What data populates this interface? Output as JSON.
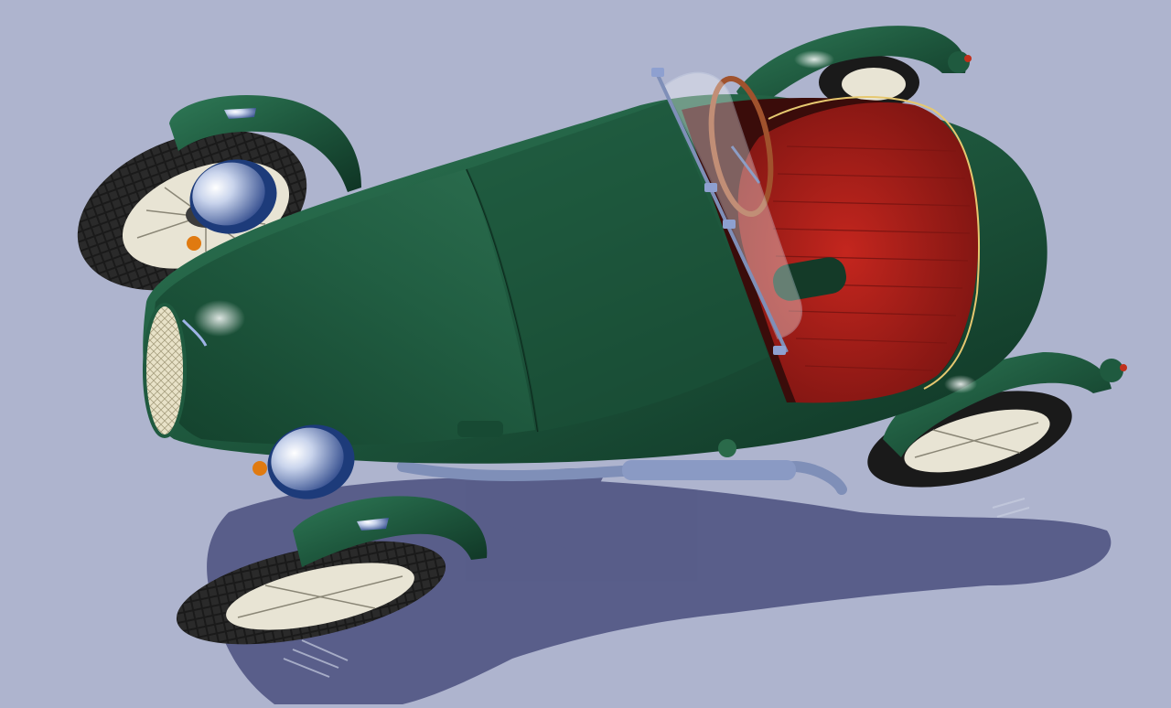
{
  "scene": {
    "subject": "vintage-roadster",
    "colors": {
      "ground": "#a9afc9",
      "ground_light": "#b8bed6",
      "shadow": "#4a4f7e",
      "body_green": "#1f5a3f",
      "body_green_dark": "#0f3424",
      "body_green_light": "#2f7a57",
      "seat_red": "#b3231c",
      "seat_red_dark": "#7e1512",
      "chrome": "#c9d4ec",
      "chrome_dark": "#4f6aa8",
      "tire": "#1a1a1a",
      "wheel_rim": "#e8e4d4",
      "steering_wood": "#a0522d",
      "indicator_amber": "#e07a10"
    }
  }
}
